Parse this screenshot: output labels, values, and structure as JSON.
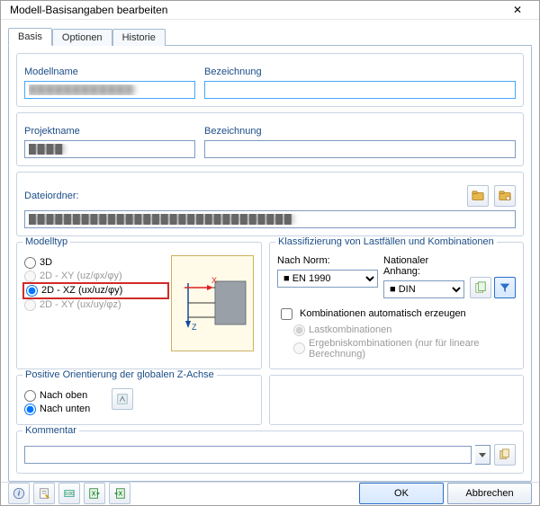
{
  "window": {
    "title": "Modell-Basisangaben bearbeiten",
    "close": "✕"
  },
  "tabs": {
    "basis": "Basis",
    "optionen": "Optionen",
    "historie": "Historie"
  },
  "modelName": {
    "label": "Modellname",
    "value": "████████████"
  },
  "modelDesc": {
    "label": "Bezeichnung",
    "value": ""
  },
  "projName": {
    "label": "Projektname",
    "value": "████"
  },
  "projDesc": {
    "label": "Bezeichnung",
    "value": ""
  },
  "folder": {
    "label": "Dateiordner:",
    "value": "██████████████████████████████"
  },
  "modelType": {
    "caption": "Modelltyp",
    "opt_3d": "3D",
    "opt_xy1": "2D - XY (uz/φx/φy)",
    "opt_xz": "2D - XZ (ux/uz/φy)",
    "opt_xy2": "2D - XY (ux/uy/φz)"
  },
  "klass": {
    "caption": "Klassifizierung von Lastfällen und Kombinationen",
    "norm_label": "Nach Norm:",
    "norm_value": "EN 1990",
    "annex_label": "Nationaler Anhang:",
    "annex_value": "DIN",
    "auto": "Kombinationen automatisch erzeugen",
    "sub1": "Lastkombinationen",
    "sub2": "Ergebniskombinationen (nur für lineare Berechnung)"
  },
  "orient": {
    "caption": "Positive Orientierung der globalen Z-Achse",
    "up": "Nach oben",
    "down": "Nach unten"
  },
  "comment": {
    "caption": "Kommentar",
    "value": ""
  },
  "buttons": {
    "ok": "OK",
    "cancel": "Abbrechen"
  }
}
